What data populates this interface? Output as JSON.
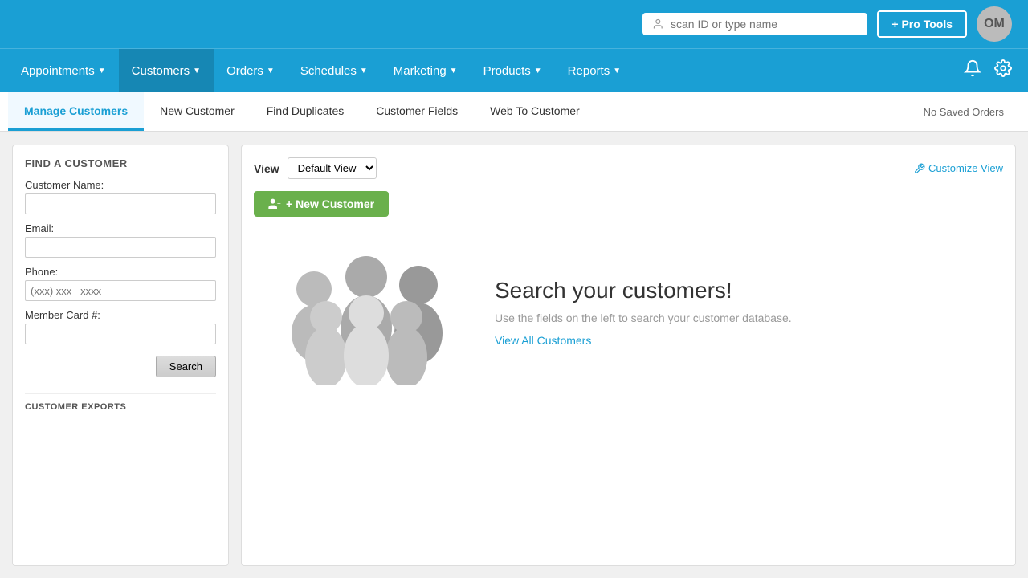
{
  "topbar": {
    "search_placeholder": "scan ID or type name",
    "pro_tools_label": "+ Pro Tools",
    "avatar_initials": "OM"
  },
  "nav": {
    "items": [
      {
        "label": "Appointments",
        "id": "appointments"
      },
      {
        "label": "Customers",
        "id": "customers"
      },
      {
        "label": "Orders",
        "id": "orders"
      },
      {
        "label": "Schedules",
        "id": "schedules"
      },
      {
        "label": "Marketing",
        "id": "marketing"
      },
      {
        "label": "Products",
        "id": "products"
      },
      {
        "label": "Reports",
        "id": "reports"
      }
    ]
  },
  "subnav": {
    "items": [
      {
        "label": "Manage Customers",
        "id": "manage-customers",
        "active": true
      },
      {
        "label": "New Customer",
        "id": "new-customer"
      },
      {
        "label": "Find Duplicates",
        "id": "find-duplicates"
      },
      {
        "label": "Customer Fields",
        "id": "customer-fields"
      },
      {
        "label": "Web To Customer",
        "id": "web-to-customer"
      }
    ],
    "no_saved_orders": "No Saved Orders"
  },
  "sidebar": {
    "title": "FIND A CUSTOMER",
    "fields": {
      "customer_name_label": "Customer Name:",
      "email_label": "Email:",
      "phone_label": "Phone:",
      "phone_placeholder": "(xxx) xxx   xxxx",
      "member_card_label": "Member Card #:"
    },
    "search_button": "Search",
    "exports_title": "CUSTOMER EXPORTS"
  },
  "content": {
    "view_label": "View",
    "view_options": [
      "Default View"
    ],
    "view_default": "Default View",
    "customize_view_label": "Customize View",
    "new_customer_label": "+ New Customer",
    "empty_state": {
      "heading": "Search your customers!",
      "description": "Use the fields on the left to search your customer database.",
      "view_all_link": "View All Customers"
    }
  }
}
